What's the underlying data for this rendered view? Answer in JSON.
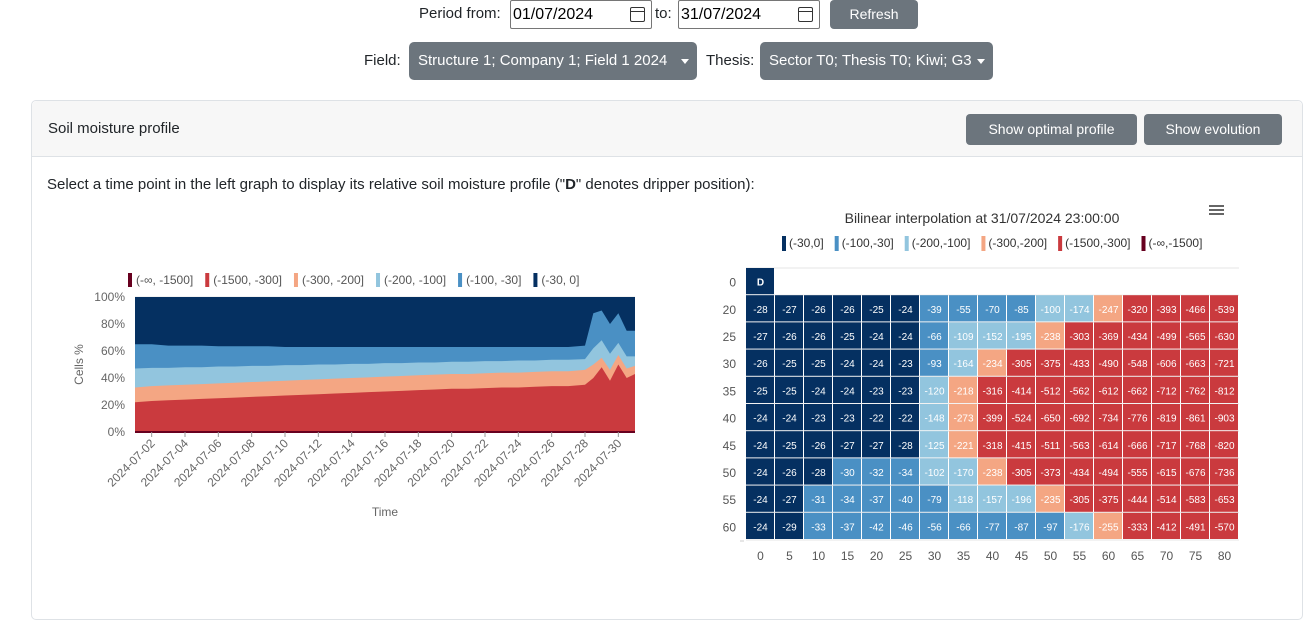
{
  "filters": {
    "period_from_label": "Period from:",
    "period_from_value": "01/07/2024",
    "to_label": "to:",
    "to_value": "31/07/2024",
    "refresh_label": "Refresh",
    "field_label": "Field:",
    "field_value": "Structure 1; Company 1; Field 1 2024",
    "thesis_label": "Thesis:",
    "thesis_value": "Sector T0; Thesis T0; Kiwi; G3"
  },
  "card": {
    "title": "Soil moisture profile",
    "optimal_button": "Show optimal profile",
    "evolution_button": "Show evolution",
    "instruction_prefix": "Select a time point in the left graph to display its relative soil moisture profile (\"",
    "instruction_bold": "D",
    "instruction_suffix": "\" denotes dripper position):"
  },
  "colors": {
    "c1": "#67001f",
    "c2": "#ca3a3e",
    "c3": "#f4a683",
    "c4": "#92c5de",
    "c5": "#4a90c4",
    "c6": "#053061"
  },
  "chart_data": [
    {
      "type": "area",
      "stacked_percent": true,
      "xlabel": "Time",
      "ylabel": "Cells %",
      "yticks": [
        "0%",
        "20%",
        "40%",
        "60%",
        "80%",
        "100%"
      ],
      "xticks": [
        "2024-07-02",
        "2024-07-04",
        "2024-07-06",
        "2024-07-08",
        "2024-07-10",
        "2024-07-12",
        "2024-07-14",
        "2024-07-16",
        "2024-07-18",
        "2024-07-20",
        "2024-07-22",
        "2024-07-24",
        "2024-07-26",
        "2024-07-28",
        "2024-07-30"
      ],
      "legend_placement": "top",
      "series": [
        {
          "name": "(-∞, -1500]",
          "color": "#67001f"
        },
        {
          "name": "(-1500, -300]",
          "color": "#ca3a3e"
        },
        {
          "name": "(-300, -200]",
          "color": "#f4a683"
        },
        {
          "name": "(-200, -100]",
          "color": "#92c5de"
        },
        {
          "name": "(-100, -30]",
          "color": "#4a90c4"
        },
        {
          "name": "(-30, 0]",
          "color": "#053061"
        }
      ],
      "days": [
        1,
        2,
        3,
        4,
        5,
        6,
        7,
        8,
        9,
        10,
        11,
        12,
        13,
        14,
        15,
        16,
        17,
        18,
        19,
        20,
        21,
        22,
        23,
        24,
        25,
        26,
        27,
        28,
        28.5,
        29,
        29.5,
        30,
        30.5,
        31
      ],
      "cum_red": [
        22,
        23,
        23.5,
        24,
        24.5,
        25,
        25.5,
        26,
        26.5,
        27,
        27.5,
        28,
        28.5,
        29,
        29.5,
        30,
        30.5,
        31,
        31.5,
        32,
        32,
        32.5,
        33,
        33,
        33.5,
        34,
        34,
        35,
        40,
        48,
        38,
        50,
        40,
        43
      ],
      "cum_salmon": [
        33,
        34,
        34.5,
        35,
        35.5,
        36,
        36.5,
        37,
        37.5,
        38,
        38.5,
        39,
        39.5,
        40,
        40.5,
        41,
        41.5,
        42,
        42.5,
        43,
        43,
        43.5,
        44,
        44,
        44.5,
        45,
        45,
        46,
        50,
        55,
        46,
        57,
        47,
        49
      ],
      "cum_light": [
        47,
        47.5,
        47.5,
        48,
        48,
        48.5,
        48.5,
        49,
        49,
        49.5,
        49.5,
        50,
        50,
        50.5,
        50.5,
        51,
        51,
        51.5,
        51.5,
        52,
        52,
        52.5,
        52.5,
        53,
        53,
        53.5,
        53.5,
        54,
        62,
        68,
        58,
        66,
        56,
        56
      ],
      "cum_mid": [
        65,
        65,
        64,
        64,
        64,
        63.5,
        63.5,
        63.5,
        63.5,
        63,
        63,
        63,
        63,
        63,
        63,
        63,
        63,
        63,
        63,
        63,
        63,
        63,
        63,
        63,
        63,
        63,
        63,
        64,
        88,
        90,
        80,
        88,
        75,
        75
      ]
    },
    {
      "type": "heatmap",
      "title": "Bilinear interpolation at 31/07/2024 23:00:00",
      "legend": [
        {
          "name": "(-30,0]",
          "color": "#053061"
        },
        {
          "name": "(-100,-30]",
          "color": "#4a90c4"
        },
        {
          "name": "(-200,-100]",
          "color": "#92c5de"
        },
        {
          "name": "(-300,-200]",
          "color": "#f4a683"
        },
        {
          "name": "(-1500,-300]",
          "color": "#ca3a3e"
        },
        {
          "name": "(-∞,-1500]",
          "color": "#67001f"
        }
      ],
      "dripper_label": "D",
      "x": [
        0,
        5,
        10,
        15,
        20,
        25,
        30,
        35,
        40,
        45,
        50,
        55,
        60,
        65,
        70,
        75,
        80
      ],
      "y": [
        0,
        20,
        25,
        30,
        35,
        40,
        45,
        50,
        55,
        60
      ],
      "rows": [
        [
          -28,
          -27,
          -26,
          -26,
          -25,
          -24,
          -39,
          -55,
          -70,
          -85,
          -100,
          -174,
          -247,
          -320,
          -393,
          -466,
          -539
        ],
        [
          -27,
          -26,
          -26,
          -25,
          -24,
          -24,
          -66,
          -109,
          -152,
          -195,
          -238,
          -303,
          -369,
          -434,
          -499,
          -565,
          -630
        ],
        [
          -26,
          -25,
          -25,
          -24,
          -24,
          -23,
          -93,
          -164,
          -234,
          -305,
          -375,
          -433,
          -490,
          -548,
          -606,
          -663,
          -721
        ],
        [
          -25,
          -25,
          -24,
          -24,
          -23,
          -23,
          -120,
          -218,
          -316,
          -414,
          -512,
          -562,
          -612,
          -662,
          -712,
          -762,
          -812
        ],
        [
          -24,
          -24,
          -23,
          -23,
          -22,
          -22,
          -148,
          -273,
          -399,
          -524,
          -650,
          -692,
          -734,
          -776,
          -819,
          -861,
          -903
        ],
        [
          -24,
          -25,
          -26,
          -27,
          -27,
          -28,
          -125,
          -221,
          -318,
          -415,
          -511,
          -563,
          -614,
          -666,
          -717,
          -768,
          -820
        ],
        [
          -24,
          -26,
          -28,
          -30,
          -32,
          -34,
          -102,
          -170,
          -238,
          -305,
          -373,
          -434,
          -494,
          -555,
          -615,
          -676,
          -736
        ],
        [
          -24,
          -27,
          -31,
          -34,
          -37,
          -40,
          -79,
          -118,
          -157,
          -196,
          -235,
          -305,
          -375,
          -444,
          -514,
          -583,
          -653
        ],
        [
          -24,
          -29,
          -33,
          -37,
          -42,
          -46,
          -56,
          -66,
          -77,
          -87,
          -97,
          -176,
          -255,
          -333,
          -412,
          -491,
          -570
        ]
      ]
    }
  ]
}
